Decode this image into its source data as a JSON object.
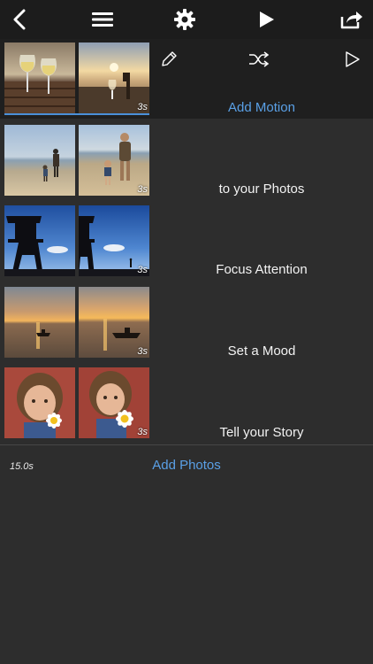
{
  "toolbar": {
    "icons": [
      "back-chevron-icon",
      "menu-icon",
      "gear-icon",
      "play-icon",
      "share-icon"
    ]
  },
  "clip_tools": {
    "icons": [
      "pencil-icon",
      "shuffle-icon",
      "play-outline-icon"
    ]
  },
  "rows": [
    {
      "caption": "Add Motion",
      "duration": "3s",
      "caption_color": "#5aa0e6",
      "selected": true,
      "scene": "wine-glasses-sunset"
    },
    {
      "caption": "to your Photos",
      "duration": "3s",
      "scene": "beach-walk"
    },
    {
      "caption": "Focus Attention",
      "duration": "3s",
      "scene": "lifeguard-tower"
    },
    {
      "caption": "Set a Mood",
      "duration": "3s",
      "scene": "sunset-boat"
    },
    {
      "caption": "Tell your Story",
      "duration": "3s",
      "scene": "girl-daisy"
    }
  ],
  "footer": {
    "total_duration": "15.0s",
    "add_photos_label": "Add Photos"
  },
  "colors": {
    "accent": "#5aa0e6",
    "background": "#2d2d2d",
    "toolbar": "#1c1c1c"
  }
}
